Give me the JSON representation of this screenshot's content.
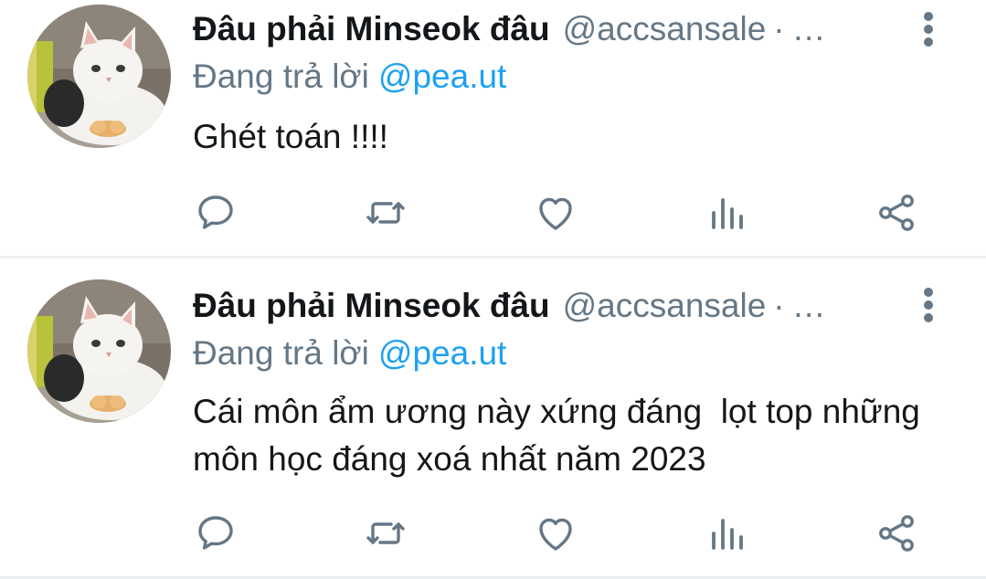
{
  "colors": {
    "text_primary": "#14171a",
    "text_secondary": "#657786",
    "link": "#1da1f2",
    "divider": "#eceff1",
    "icon": "#657786"
  },
  "icons": {
    "reply": "speech-bubble-icon",
    "retweet": "retweet-arrows-icon",
    "like": "heart-icon",
    "views": "bar-chart-icon",
    "share": "share-nodes-icon",
    "more": "vertical-dots-icon"
  },
  "tweets": [
    {
      "display_name": "Đâu phải Minseok đâu",
      "handle": "@accsansale",
      "separator": "·",
      "truncation": "…",
      "reply_prefix": "Đang trả lời",
      "reply_to": "@pea.ut",
      "text": "Ghét toán !!!!"
    },
    {
      "display_name": "Đâu phải Minseok đâu",
      "handle": "@accsansale",
      "separator": "·",
      "truncation": "…",
      "reply_prefix": "Đang trả lời",
      "reply_to": "@pea.ut",
      "text": "Cái môn ẩm ương này xứng đáng  lọt top những môn học đáng xoá nhất năm 2023"
    }
  ]
}
